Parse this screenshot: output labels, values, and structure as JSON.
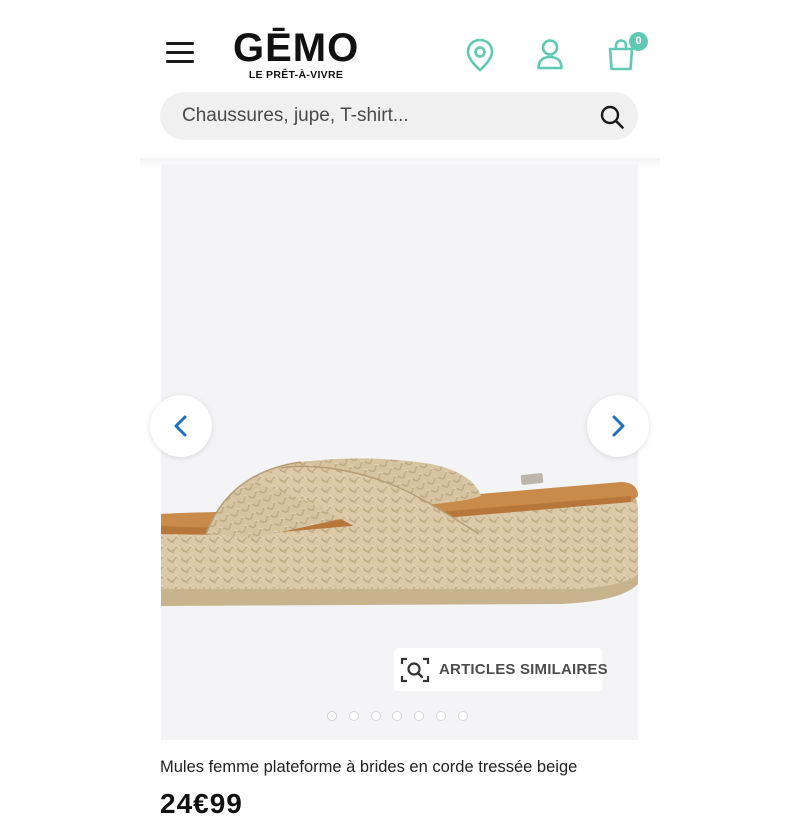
{
  "header": {
    "logo_word": "GĒMO",
    "logo_tagline": "LE PRÊT-À-VIVRE",
    "icons": {
      "menu": "hamburger-menu-icon",
      "store": "location-pin-icon",
      "account": "user-icon",
      "cart": "shopping-bag-icon"
    },
    "cart_count": "0"
  },
  "search": {
    "placeholder": "Chaussures, jupe, T-shirt..."
  },
  "gallery": {
    "similar_label": "ARTICLES SIMILAIRES",
    "slide_count": 7,
    "active_slide": 0
  },
  "product": {
    "title": "Mules femme plateforme à brides en corde tressée beige",
    "price": "24€99"
  },
  "colors": {
    "accent": "#5fc9b3",
    "arrow": "#1e6fc0",
    "text": "#222222"
  }
}
